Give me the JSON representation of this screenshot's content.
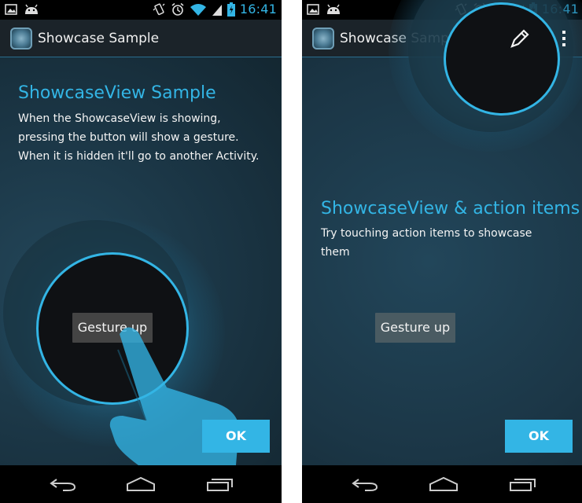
{
  "status_bar": {
    "time": "16:41",
    "left_icons": [
      "image-icon",
      "android-icon"
    ],
    "right_icons": [
      "vibrate-icon",
      "alarm-icon",
      "wifi-icon",
      "signal-icon",
      "battery-icon"
    ]
  },
  "screens": [
    {
      "app_title": "Showcase Sample",
      "heading": "ShowcaseView Sample",
      "body_lines": [
        "When the ShowcaseView is showing,",
        "pressing the button will show a gesture.",
        "When it is hidden it'll go to another Activity."
      ],
      "gesture_button": "Gesture up",
      "ok_button": "OK"
    },
    {
      "app_title": "Showcase Sample",
      "heading": "ShowcaseView & action items",
      "body_lines": [
        "Try touching action items to showcase",
        "them"
      ],
      "gesture_button": "Gesture up",
      "ok_button": "OK",
      "actions": [
        "pencil-icon",
        "overflow-menu-icon"
      ]
    }
  ],
  "navigation": [
    "back-icon",
    "home-icon",
    "recent-apps-icon"
  ],
  "colors": {
    "accent": "#33b5e5",
    "background": "#1b3646",
    "button": "#444444"
  }
}
